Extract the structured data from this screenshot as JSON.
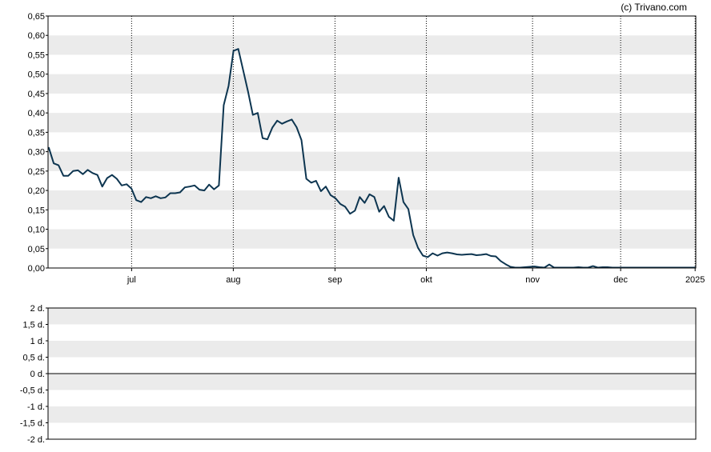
{
  "credit": "(c) Trivano.com",
  "colors": {
    "line": "#0d3550",
    "band": "#ebebeb",
    "frame": "#000000",
    "vgrid": "#000000",
    "background": "#ffffff"
  },
  "chart_data": [
    {
      "type": "line",
      "title": "",
      "xlabel": "",
      "ylabel": "",
      "ylim": [
        0,
        0.65
      ],
      "grid": true,
      "y_ticks": [
        "0,00",
        "0,05",
        "0,10",
        "0,15",
        "0,20",
        "0,25",
        "0,30",
        "0,35",
        "0,40",
        "0,45",
        "0,50",
        "0,55",
        "0,60",
        "0,65"
      ],
      "x_labels": [
        "jul",
        "aug",
        "sep",
        "okt",
        "nov",
        "dec",
        "2025"
      ],
      "series": [
        {
          "values": [
            0.31,
            0.27,
            0.265,
            0.238,
            0.238,
            0.25,
            0.252,
            0.242,
            0.253,
            0.245,
            0.24,
            0.21,
            0.232,
            0.24,
            0.23,
            0.213,
            0.216,
            0.205,
            0.175,
            0.17,
            0.183,
            0.18,
            0.185,
            0.18,
            0.182,
            0.193,
            0.193,
            0.195,
            0.208,
            0.21,
            0.213,
            0.202,
            0.2,
            0.215,
            0.203,
            0.213,
            0.42,
            0.47,
            0.56,
            0.565,
            0.51,
            0.455,
            0.395,
            0.4,
            0.335,
            0.332,
            0.362,
            0.38,
            0.372,
            0.378,
            0.383,
            0.363,
            0.33,
            0.23,
            0.22,
            0.225,
            0.198,
            0.21,
            0.188,
            0.18,
            0.165,
            0.158,
            0.14,
            0.148,
            0.183,
            0.168,
            0.19,
            0.183,
            0.145,
            0.16,
            0.132,
            0.122,
            0.233,
            0.17,
            0.152,
            0.085,
            0.052,
            0.032,
            0.028,
            0.038,
            0.032,
            0.038,
            0.04,
            0.038,
            0.035,
            0.034,
            0.035,
            0.036,
            0.033,
            0.034,
            0.036,
            0.031,
            0.03,
            0.018,
            0.01,
            0.003,
            0.001,
            0.001,
            0.002,
            0.003,
            0.004,
            0.002,
            0.001,
            0.009,
            0.001,
            0.001,
            0.001,
            0.001,
            0.001,
            0.002,
            0.001,
            0.001,
            0.005,
            0.001,
            0.002,
            0.002,
            0.001,
            0.001,
            0.001,
            0.001,
            0.001,
            0.001,
            0.001,
            0.001,
            0.001,
            0.001,
            0.001,
            0.001,
            0.001,
            0.001,
            0.001,
            0.001,
            0.001,
            0.001
          ]
        }
      ]
    },
    {
      "type": "line",
      "title": "",
      "xlabel": "",
      "ylabel": "",
      "ylim": [
        -2,
        2
      ],
      "grid": true,
      "y_ticks": [
        "2 d.",
        "1,5 d.",
        "1 d.",
        "0,5 d.",
        "0 d.",
        "-0,5 d.",
        "-1 d.",
        "-1,5 d.",
        "-2 d."
      ],
      "series": []
    }
  ]
}
